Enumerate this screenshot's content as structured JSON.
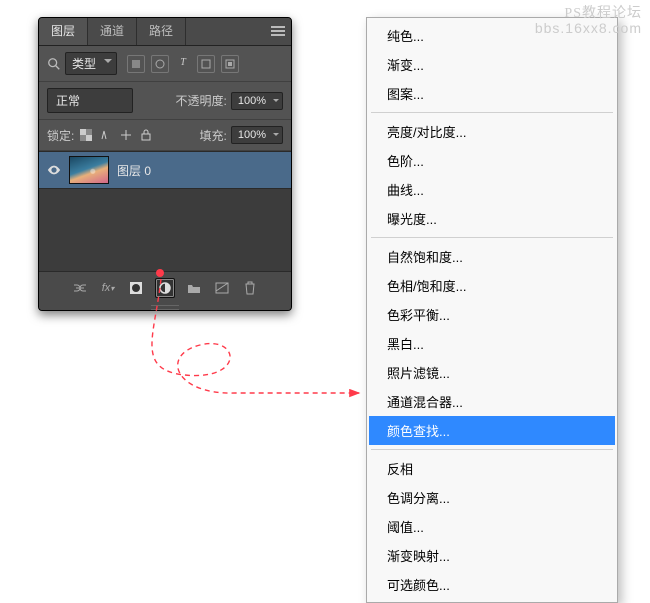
{
  "watermarks": {
    "line1": "PS教程论坛",
    "line2": "bbs.16xx8.com"
  },
  "panel": {
    "tabs": [
      "图层",
      "通道",
      "路径"
    ],
    "active_tab": 0,
    "filter": {
      "label": "类型"
    },
    "icons": {
      "t": "T"
    },
    "blend": {
      "mode": "正常",
      "opacity_label": "不透明度:",
      "opacity_value": "100%"
    },
    "lock": {
      "label": "锁定:",
      "fill_label": "填充:",
      "fill_value": "100%"
    },
    "layers": [
      {
        "name": "图层 0"
      }
    ]
  },
  "menu": {
    "groups": [
      [
        "纯色...",
        "渐变...",
        "图案..."
      ],
      [
        "亮度/对比度...",
        "色阶...",
        "曲线...",
        "曝光度..."
      ],
      [
        "自然饱和度...",
        "色相/饱和度...",
        "色彩平衡...",
        "黑白...",
        "照片滤镜...",
        "通道混合器...",
        "颜色查找..."
      ],
      [
        "反相",
        "色调分离...",
        "阈值...",
        "渐变映射...",
        "可选颜色..."
      ]
    ],
    "highlighted": "颜色查找..."
  }
}
